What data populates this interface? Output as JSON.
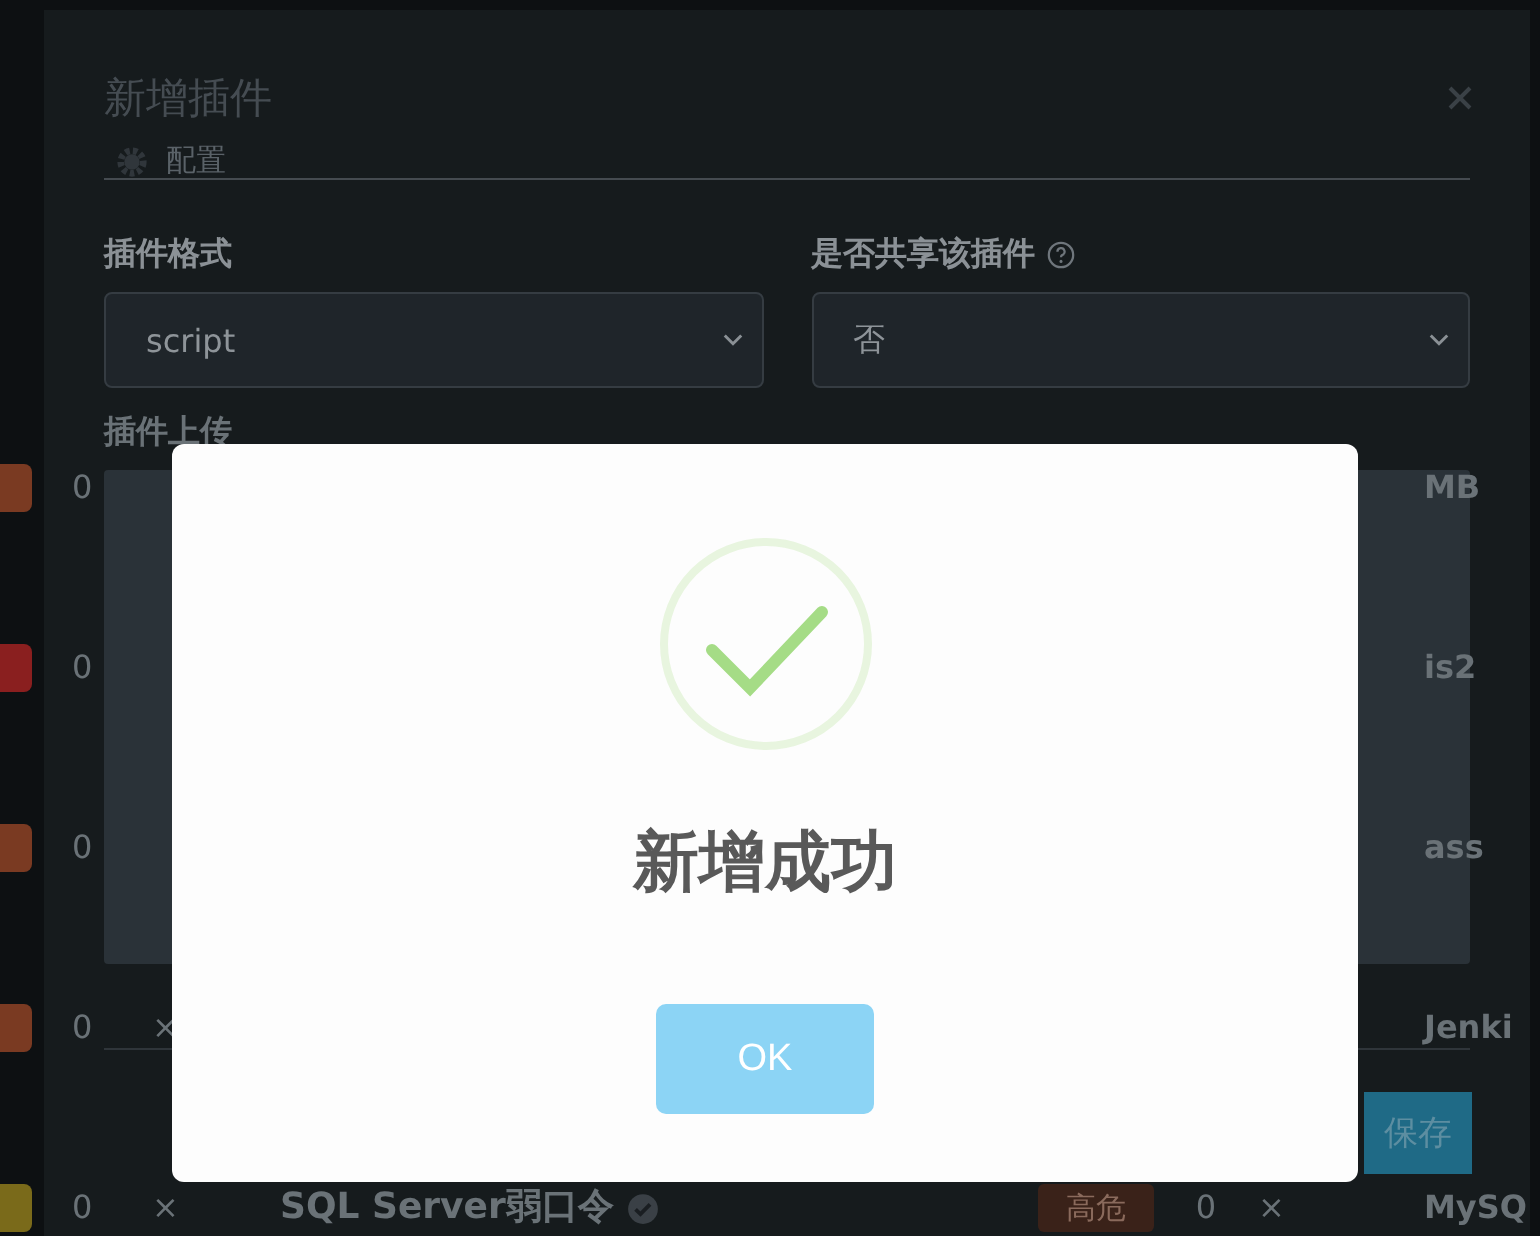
{
  "background_rows": [
    {
      "color": "#7a3a22",
      "count": "0",
      "right_text": "MB"
    },
    {
      "color": "#8a1f1f",
      "count": "0",
      "right_text": "is2"
    },
    {
      "color": "#7a3a22",
      "count": "0",
      "right_text": "ass"
    },
    {
      "color": "#7a3a22",
      "count": "0",
      "mark": "×",
      "right_text": "Jenki"
    },
    {
      "color": "#7a6a1a",
      "count": "0",
      "mark": "×",
      "title": "SQL Server弱口令",
      "level_badge": "高危",
      "count_2": "0",
      "mark_2": "×",
      "right_text": "MySQ"
    }
  ],
  "plugin_dialog": {
    "title": "新增插件",
    "tab": {
      "label": "配置"
    },
    "fields": [
      {
        "label": "插件格式",
        "value": "script",
        "help": false
      },
      {
        "label": "是否共享该插件",
        "value": "否",
        "help": true
      }
    ],
    "upload_label": "插件上传",
    "save_button": "保存"
  },
  "alert": {
    "title": "新增成功",
    "button": "OK"
  }
}
